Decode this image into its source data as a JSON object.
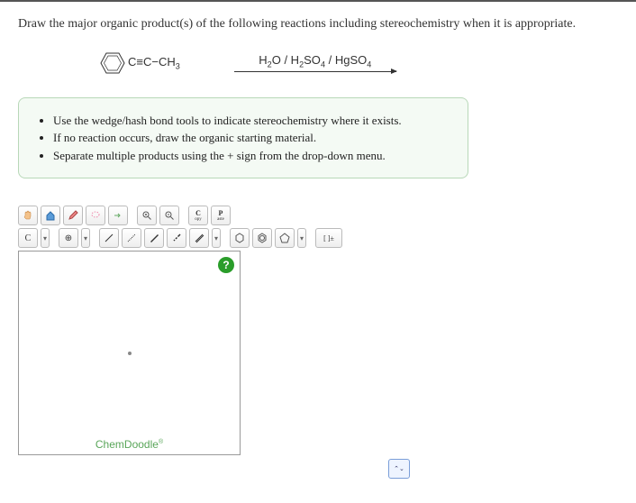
{
  "question": "Draw the major organic product(s) of the following reactions including stereochemistry when it is appropriate.",
  "reactant_text": "C≡C−CH",
  "reactant_sub": "3",
  "reagent": {
    "part1": "H",
    "sub1": "2",
    "part2": "O / H",
    "sub2": "2",
    "part3": "SO",
    "sub3": "4",
    "part4": " / HgSO",
    "sub4": "4"
  },
  "instructions": [
    "Use the wedge/hash bond tools to indicate stereochemistry where it exists.",
    "If no reaction occurs, draw the organic starting material.",
    "Separate multiple products using the + sign from the drop-down menu."
  ],
  "tools1": {
    "copy": "C",
    "copy_sub": "opy",
    "paste": "P",
    "paste_sub": "aste"
  },
  "tools2": {
    "element": "C",
    "charge": "⊕",
    "bracket": "[ ]±"
  },
  "brand": "ChemDoodle",
  "brand_sup": "®",
  "help": "?",
  "dd": "▾",
  "stepper": "⌃⌄"
}
